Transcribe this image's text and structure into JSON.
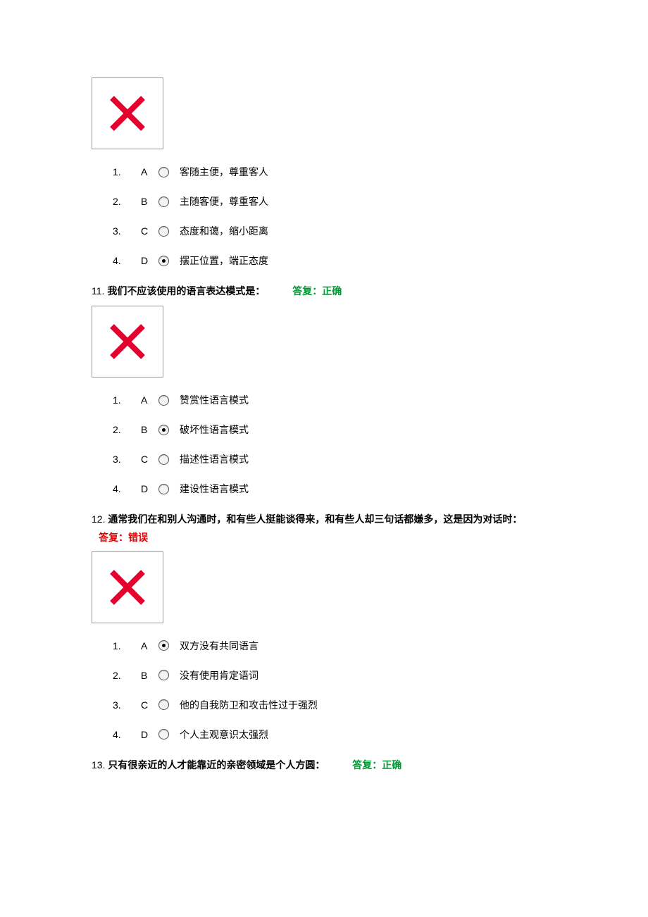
{
  "q10": {
    "options": [
      {
        "num": "1.",
        "letter": "A",
        "selected": false,
        "text": "客随主便，尊重客人"
      },
      {
        "num": "2.",
        "letter": "B",
        "selected": false,
        "text": "主随客便，尊重客人"
      },
      {
        "num": "3.",
        "letter": "C",
        "selected": false,
        "text": "态度和蔼，缩小距离"
      },
      {
        "num": "4.",
        "letter": "D",
        "selected": true,
        "text": "摆正位置，端正态度"
      }
    ]
  },
  "q11": {
    "number": "11.",
    "text": "我们不应该使用的语言表达模式是：",
    "answer_label": "答复：正确",
    "answer_state": "correct",
    "options": [
      {
        "num": "1.",
        "letter": "A",
        "selected": false,
        "text": "赞赏性语言模式"
      },
      {
        "num": "2.",
        "letter": "B",
        "selected": true,
        "text": "破坏性语言模式"
      },
      {
        "num": "3.",
        "letter": "C",
        "selected": false,
        "text": "描述性语言模式"
      },
      {
        "num": "4.",
        "letter": "D",
        "selected": false,
        "text": "建设性语言模式"
      }
    ]
  },
  "q12": {
    "number": "12.",
    "text": "通常我们在和别人沟通时，和有些人挺能谈得来，和有些人却三句话都嫌多，这是因为对话时：",
    "answer_label": "答复：错误",
    "answer_state": "wrong",
    "options": [
      {
        "num": "1.",
        "letter": "A",
        "selected": true,
        "text": "双方没有共同语言"
      },
      {
        "num": "2.",
        "letter": "B",
        "selected": false,
        "text": "没有使用肯定语词"
      },
      {
        "num": "3.",
        "letter": "C",
        "selected": false,
        "text": "他的自我防卫和攻击性过于强烈"
      },
      {
        "num": "4.",
        "letter": "D",
        "selected": false,
        "text": "个人主观意识太强烈"
      }
    ]
  },
  "q13": {
    "number": "13.",
    "text": "只有很亲近的人才能靠近的亲密领域是个人方圆：",
    "answer_label": "答复：正确",
    "answer_state": "correct"
  }
}
